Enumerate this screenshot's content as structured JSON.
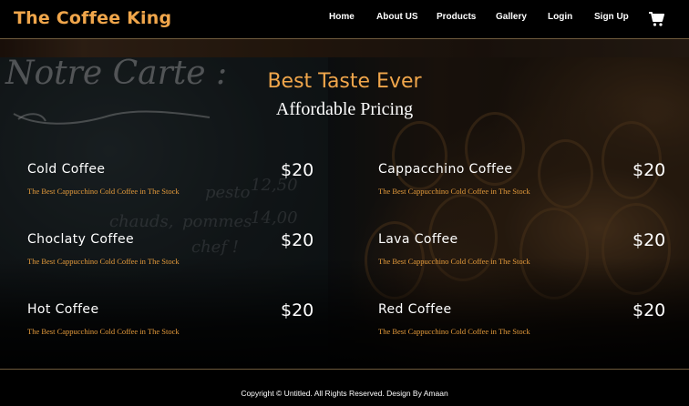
{
  "header": {
    "brand": "The Coffee King",
    "nav": [
      "Home",
      "About US",
      "Products",
      "Gallery",
      "Login",
      "Sign Up"
    ],
    "cart_icon": "shopping-cart-icon"
  },
  "hero": {
    "title": "Best Taste Ever",
    "subtitle": "Affordable Pricing",
    "background_chalk_title": "Notre Carte :",
    "background_chalk_lines": [
      "12,50",
      "pesto",
      "14,00",
      "pommes",
      "chauds,",
      "chef !"
    ]
  },
  "menu": {
    "items": [
      {
        "name": "Cold Coffee",
        "price": "$20",
        "desc": "The Best Cappucchino Cold Coffee in The Stock"
      },
      {
        "name": "Cappacchino Coffee",
        "price": "$20",
        "desc": "The Best Cappucchino Cold Coffee in The Stock"
      },
      {
        "name": "Choclaty Coffee",
        "price": "$20",
        "desc": "The Best Cappucchino Cold Coffee in The Stock"
      },
      {
        "name": "Lava Coffee",
        "price": "$20",
        "desc": "The Best Cappucchino Cold Coffee in The Stock"
      },
      {
        "name": "Hot Coffee",
        "price": "$20",
        "desc": "The Best Cappucchino Cold Coffee in The Stock"
      },
      {
        "name": "Red Coffee",
        "price": "$20",
        "desc": "The Best Cappucchino Cold Coffee in The Stock"
      }
    ]
  },
  "footer": {
    "copyright": "Copyright © Untitled. All Rights Reserved. Design By Amaan"
  },
  "colors": {
    "accent": "#f0a64b",
    "description": "#e39a3b",
    "background": "#000000"
  }
}
